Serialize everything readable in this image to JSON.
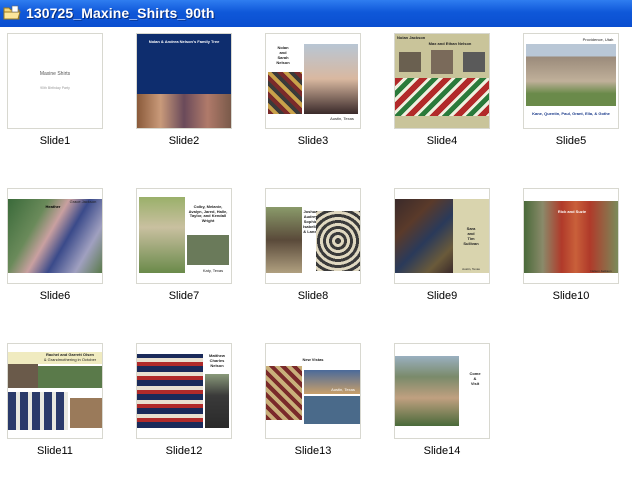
{
  "window": {
    "title": "130725_Maxine_Shirts_90th",
    "icon": "folder-icon"
  },
  "slides": [
    {
      "label": "Slide1",
      "text": [
        "Maxine Shirts",
        "90th Birthday Party"
      ]
    },
    {
      "label": "Slide2",
      "text": [
        "Nolan & Andrea Nelson's Family Tree"
      ]
    },
    {
      "label": "Slide3",
      "text": [
        "Nolan",
        "and",
        "Sarah",
        "Nelson",
        "Austin, Texas"
      ]
    },
    {
      "label": "Slide4",
      "text": [
        "Nolan Jackson",
        "Max and Ethan Nelson"
      ]
    },
    {
      "label": "Slide5",
      "text": [
        "Providence, Utah",
        "Kane, Quentin, Paul, Grant, Ella, & Gothe"
      ]
    },
    {
      "label": "Slide6",
      "text": [
        "Heather",
        "Grace Jackson"
      ]
    },
    {
      "label": "Slide7",
      "text": [
        "Colby, Melanie, Avalyn, Jared, Halle, Taylor, and Kendall Wright",
        "Katy, Texas"
      ]
    },
    {
      "label": "Slide8",
      "text": [
        "Joshua,",
        "Audrey,",
        "Sophia,",
        "Isabella,",
        "& Lanes"
      ]
    },
    {
      "label": "Slide9",
      "text": [
        "Sara",
        "and",
        "Tim",
        "Sullivan",
        "Austin, Texas"
      ]
    },
    {
      "label": "Slide10",
      "text": [
        "Rick and Suzie",
        "Nelson Jackson"
      ]
    },
    {
      "label": "Slide11",
      "text": [
        "Rachel and Garrett Olsen",
        "& Grandmothering in October"
      ]
    },
    {
      "label": "Slide12",
      "text": [
        "Matthew",
        "Charles",
        "Nelson"
      ]
    },
    {
      "label": "Slide13",
      "text": [
        "New Vistas",
        "Austin, Texas"
      ]
    },
    {
      "label": "Slide14",
      "text": [
        "Come",
        "&",
        "Visit"
      ]
    }
  ]
}
